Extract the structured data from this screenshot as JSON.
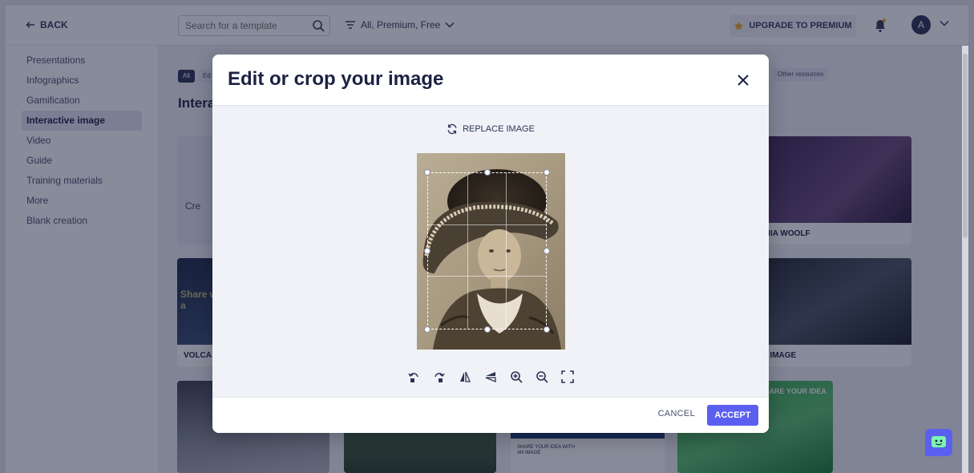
{
  "topbar": {
    "back_label": "BACK",
    "search_placeholder": "Search for a template",
    "filter_label": "All, Premium, Free",
    "upgrade_label": "UPGRADE TO PREMIUM",
    "avatar_initial": "A"
  },
  "sidebar": {
    "items": [
      {
        "label": "Presentations"
      },
      {
        "label": "Infographics"
      },
      {
        "label": "Gamification"
      },
      {
        "label": "Interactive image"
      },
      {
        "label": "Video"
      },
      {
        "label": "Guide"
      },
      {
        "label": "Training materials"
      },
      {
        "label": "More"
      },
      {
        "label": "Blank creation"
      }
    ],
    "active": "Interactive image"
  },
  "content": {
    "chip_all": "All",
    "chip_all_partial": "Ed",
    "chip_other": "Other resources",
    "title_partial": "Intera",
    "cards": {
      "create_partial": "Cre",
      "virginia": "INIA WOOLF",
      "volcano": "VOLCA",
      "share_partial": "Share with a",
      "image": "E IMAGE",
      "share_idea": "SHARE YOUR IDEA WITH AN IMAGE",
      "share_idea_banner": "HARE YOUR IDEA"
    }
  },
  "modal": {
    "title": "Edit or crop your image",
    "replace_label": "REPLACE IMAGE",
    "cancel_label": "CANCEL",
    "accept_label": "ACCEPT",
    "tools": [
      {
        "icon": "rotate-left-icon"
      },
      {
        "icon": "rotate-right-icon"
      },
      {
        "icon": "flip-horizontal-icon"
      },
      {
        "icon": "flip-vertical-icon"
      },
      {
        "icon": "zoom-in-icon"
      },
      {
        "icon": "zoom-out-icon"
      },
      {
        "icon": "fit-icon"
      }
    ]
  },
  "colors": {
    "accent": "#5b5ff0",
    "navy": "#1c2243",
    "overlay": "rgba(18,24,52,0.50)"
  }
}
